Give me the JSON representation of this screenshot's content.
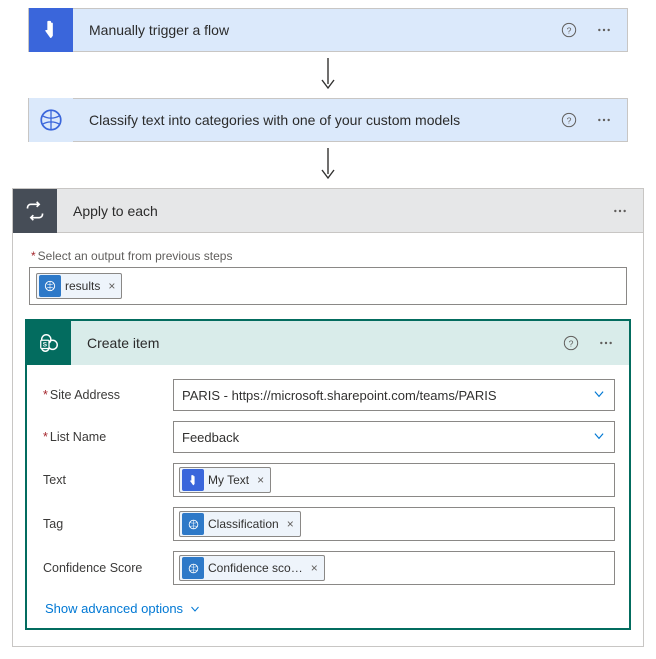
{
  "step1": {
    "title": "Manually trigger a flow"
  },
  "step2": {
    "title": "Classify text into categories with one of your custom models"
  },
  "loop": {
    "title": "Apply to each",
    "selectLabel": "Select an output from previous steps",
    "token": "results"
  },
  "create": {
    "title": "Create item",
    "rows": {
      "siteAddress": {
        "label": "Site Address",
        "value": "PARIS - https://microsoft.sharepoint.com/teams/PARIS"
      },
      "listName": {
        "label": "List Name",
        "value": "Feedback"
      },
      "text": {
        "label": "Text",
        "token": "My Text"
      },
      "tag": {
        "label": "Tag",
        "token": "Classification"
      },
      "conf": {
        "label": "Confidence Score",
        "token": "Confidence sco…"
      }
    },
    "advanced": "Show advanced options"
  }
}
